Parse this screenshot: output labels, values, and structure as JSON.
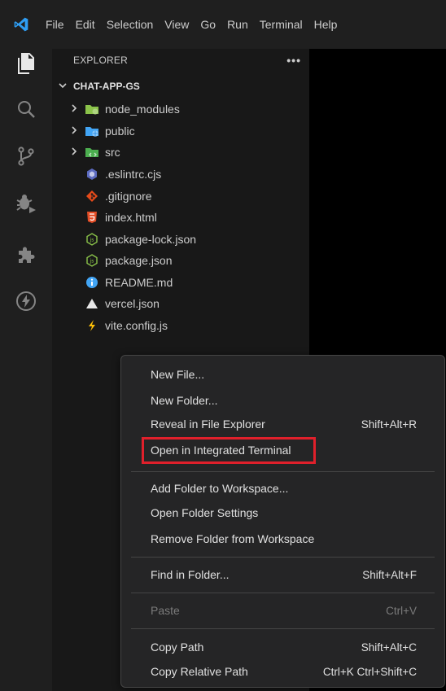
{
  "titlebar": {
    "menu": [
      "File",
      "Edit",
      "Selection",
      "View",
      "Go",
      "Run",
      "Terminal",
      "Help"
    ]
  },
  "activity_bar": {
    "icons": [
      "files-icon",
      "search-icon",
      "source-control-icon",
      "run-debug-icon",
      "extensions-icon",
      "lightning-icon"
    ]
  },
  "explorer": {
    "title": "EXPLORER",
    "more": "•••",
    "root_label": "CHAT-APP-GS",
    "folders": [
      {
        "name": "node_modules",
        "icon": "node-modules-folder-icon",
        "color": "#8bc34a"
      },
      {
        "name": "public",
        "icon": "public-folder-icon",
        "color": "#42a5f5"
      },
      {
        "name": "src",
        "icon": "src-folder-icon",
        "color": "#4caf50"
      }
    ],
    "files": [
      {
        "name": ".eslintrc.cjs",
        "icon": "eslint-icon"
      },
      {
        "name": ".gitignore",
        "icon": "git-icon"
      },
      {
        "name": "index.html",
        "icon": "html-icon"
      },
      {
        "name": "package-lock.json",
        "icon": "nodejs-icon"
      },
      {
        "name": "package.json",
        "icon": "nodejs-icon"
      },
      {
        "name": "README.md",
        "icon": "info-icon"
      },
      {
        "name": "vercel.json",
        "icon": "vercel-icon"
      },
      {
        "name": "vite.config.js",
        "icon": "vite-icon"
      }
    ]
  },
  "context_menu": {
    "items": [
      {
        "label": "New File...",
        "shortcut": ""
      },
      {
        "label": "New Folder...",
        "shortcut": ""
      },
      {
        "label": "Reveal in File Explorer",
        "shortcut": "Shift+Alt+R"
      },
      {
        "label": "Open in Integrated Terminal",
        "shortcut": "",
        "highlighted": true
      },
      {
        "label": "Add Folder to Workspace...",
        "shortcut": ""
      },
      {
        "label": "Open Folder Settings",
        "shortcut": ""
      },
      {
        "label": "Remove Folder from Workspace",
        "shortcut": ""
      },
      {
        "label": "Find in Folder...",
        "shortcut": "Shift+Alt+F"
      },
      {
        "label": "Paste",
        "shortcut": "Ctrl+V",
        "disabled": true
      },
      {
        "label": "Copy Path",
        "shortcut": "Shift+Alt+C"
      },
      {
        "label": "Copy Relative Path",
        "shortcut": "Ctrl+K Ctrl+Shift+C"
      }
    ]
  },
  "colors": {
    "accent_blue": "#0078d4",
    "highlight_red": "#e0202b"
  }
}
